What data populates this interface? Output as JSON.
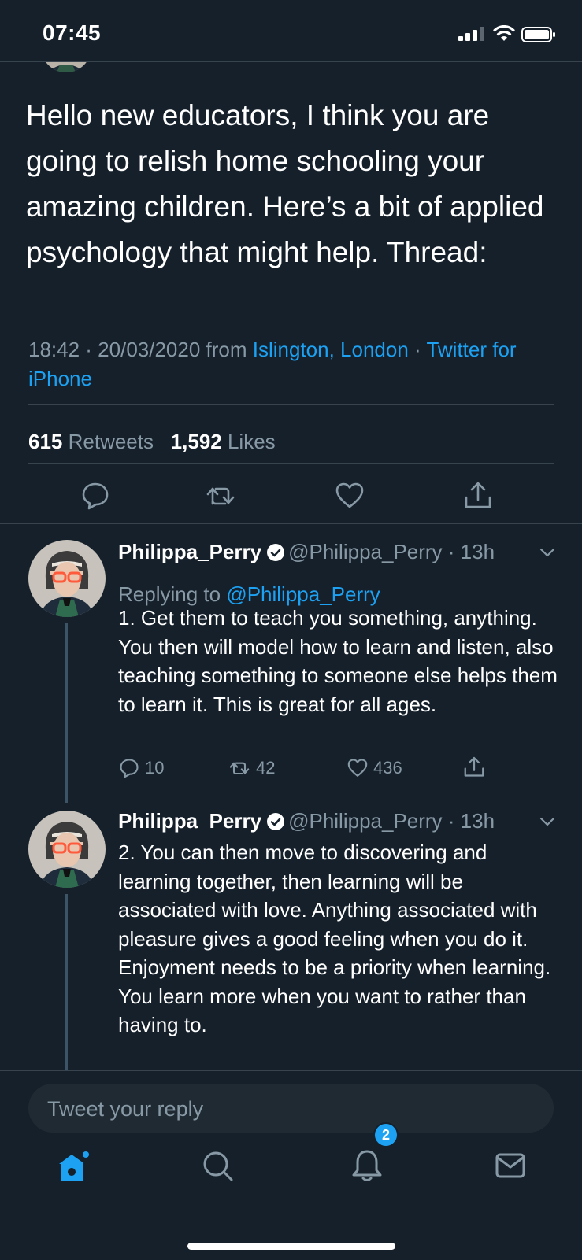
{
  "status_bar": {
    "time": "07:45"
  },
  "main_tweet": {
    "text": "Hello new educators, I think you are going to relish home schooling your amazing children. Here’s a bit of applied psychology that might help. Thread:",
    "time": "18:42 · 20/03/2020 from ",
    "location": "Islington, London",
    "separator": " · ",
    "client": "Twitter for iPhone",
    "retweets_count": "615",
    "retweets_label": " Retweets",
    "likes_count": "1,592",
    "likes_label": " Likes"
  },
  "replies": [
    {
      "name": "Philippa_Perry",
      "handle": "@Philippa_Perry · 13h",
      "replying_prefix": "Replying to ",
      "replying_handle": "@Philippa_Perry",
      "text": "1. Get them to teach you something, anything. You then will model how to learn and listen, also teaching something to someone else helps them to learn it. This is great for all ages.",
      "replies_count": "10",
      "retweets_count": "42",
      "likes_count": "436"
    },
    {
      "name": "Philippa_Perry",
      "handle": "@Philippa_Perry · 13h",
      "text": "2. You can then move to discovering and learning together, then learning will be associated with love. Anything associated with pleasure gives a good feeling when you do it. Enjoyment needs to be a priority when learning. You learn more when you want to rather than having to."
    }
  ],
  "reply_box": {
    "placeholder": "Tweet your reply"
  },
  "tab_bar": {
    "notifications_badge": "2"
  },
  "colors": {
    "background": "#15202b",
    "accent": "#1da1f2",
    "muted": "#8899a6",
    "divider": "#38444d"
  },
  "icons": [
    "signal-icon",
    "wifi-icon",
    "battery-icon",
    "reply-icon",
    "retweet-icon",
    "like-icon",
    "share-icon",
    "verified-icon",
    "chevron-down-icon",
    "home-icon",
    "search-icon",
    "bell-icon",
    "mail-icon"
  ]
}
